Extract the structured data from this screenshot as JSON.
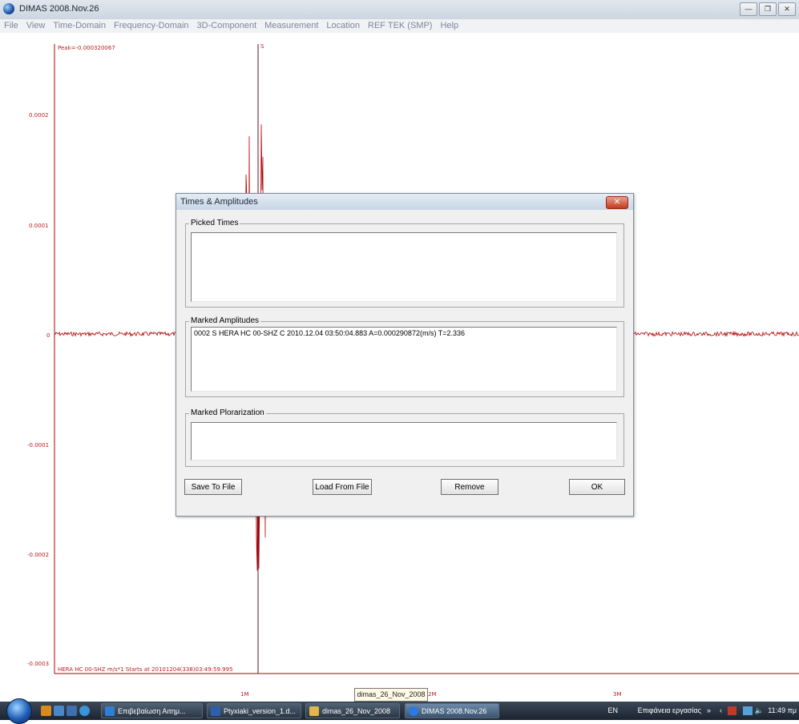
{
  "window": {
    "title": "DIMAS 2008.Nov.26"
  },
  "menu": [
    "File",
    "View",
    "Time-Domain",
    "Frequency-Domain",
    "3D-Component",
    "Measurement",
    "Location",
    "REF TEK (SMP)",
    "Help"
  ],
  "plot": {
    "peak_label": "Peak=-0.000320067",
    "pick_marker": "S",
    "trace_info": "HERA HC 00-SHZ  m/s*1 Starts at 20101204(338)03:49:59.995",
    "y_ticks": [
      "0.0002",
      "0.0001",
      "0",
      "-0.0001",
      "-0.0002",
      "-0.0003"
    ],
    "x_ticks": [
      "1M",
      "2M",
      "3M"
    ],
    "trace_color": "#b00000"
  },
  "dialog": {
    "title": "Times & Amplitudes",
    "picked_times_label": "Picked Times",
    "marked_amplitudes_label": "Marked Amplitudes",
    "marked_amplitudes_items": [
      "0002 S HERA HC 00-SHZ C 2010.12.04 03:50:04.883 A=0.000290872(m/s) T=2.336"
    ],
    "marked_polarization_label": "Marked Plorarization",
    "buttons": {
      "save": "Save To File",
      "load": "Load From File",
      "remove": "Remove",
      "ok": "OK"
    }
  },
  "tooltip": "dimas_26_Nov_2008",
  "taskbar": {
    "tasks": [
      "Επιβεβαίωση Αιτημ...",
      "Ptyxiaki_version_1.d...",
      "dimas_26_Nov_2008",
      "DIMAS 2008.Nov.26"
    ],
    "lang": "EN",
    "desktop": "Επιφάνεια εργασίας",
    "chevron": "»",
    "time": "11:49 πμ"
  }
}
